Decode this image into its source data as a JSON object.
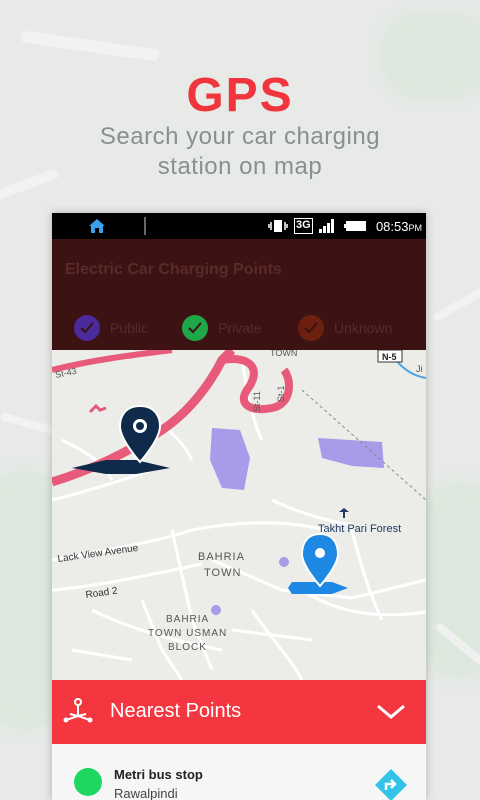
{
  "promo": {
    "headline": "GPS",
    "subline_1": "Search your car charging",
    "subline_2": "station on map"
  },
  "status_bar": {
    "network": "3G",
    "time": "08:53",
    "ampm": "PM"
  },
  "app": {
    "title": "Electric Car Charging Points",
    "legend": [
      {
        "label": "Public",
        "color": "#4b2a9b"
      },
      {
        "label": "Private",
        "color": "#1ea84a"
      },
      {
        "label": "Unknown",
        "color": "#6e2010"
      }
    ]
  },
  "map": {
    "labels": {
      "town_top": "TOWN",
      "n5": "N-5",
      "st43": "St-43",
      "st11": "St-11",
      "st1": "St-1",
      "ji": "Ji",
      "forest": "Takht Pari Forest",
      "lake_view": "Lack View Avenue",
      "bahria_1": "BAHRIA",
      "bahria_2": "TOWN",
      "road2": "Road 2",
      "usman_1": "BAHRIA",
      "usman_2": "TOWN USMAN",
      "usman_3": "BLOCK"
    }
  },
  "nearest": {
    "label": "Nearest Points",
    "items": [
      {
        "name": "Metri bus stop",
        "city": "Rawalpindi",
        "status_color": "#1ed760"
      }
    ]
  },
  "colors": {
    "accent": "#f3363f",
    "headline": "#f0353c",
    "appbar": "#3d1212",
    "pin_dark": "#0f2a4a",
    "pin_blue": "#1e88e5"
  }
}
